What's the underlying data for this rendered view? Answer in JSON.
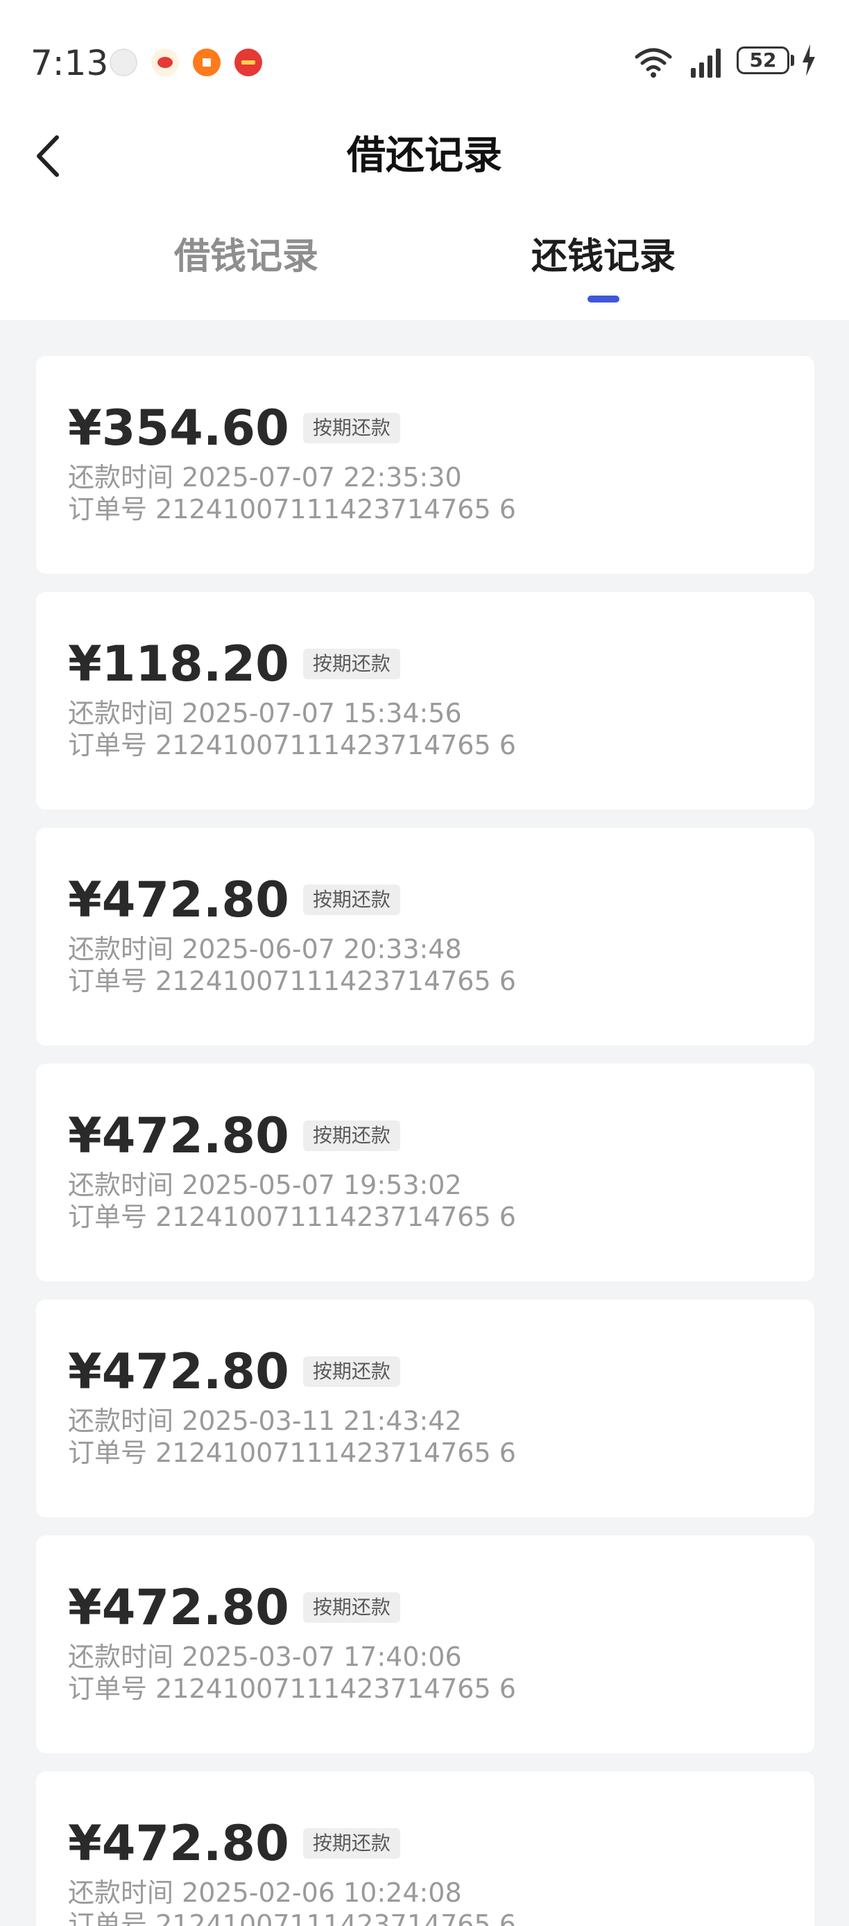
{
  "status_bar": {
    "time": "7:13",
    "battery": "52"
  },
  "header": {
    "title": "借还记录"
  },
  "tabs": [
    {
      "label": "借钱记录",
      "active": false
    },
    {
      "label": "还钱记录",
      "active": true
    }
  ],
  "colors": {
    "accent": "#3f56d8",
    "background": "#f3f4f6"
  },
  "records": [
    {
      "amount": "¥354.60",
      "tag": "按期还款",
      "time_text": "还款时间 2025-07-07 22:35:30",
      "order_text": "订单号 21241007111423714765 6"
    },
    {
      "amount": "¥118.20",
      "tag": "按期还款",
      "time_text": "还款时间 2025-07-07 15:34:56",
      "order_text": "订单号 21241007111423714765 6"
    },
    {
      "amount": "¥472.80",
      "tag": "按期还款",
      "time_text": "还款时间 2025-06-07 20:33:48",
      "order_text": "订单号 21241007111423714765 6"
    },
    {
      "amount": "¥472.80",
      "tag": "按期还款",
      "time_text": "还款时间 2025-05-07 19:53:02",
      "order_text": "订单号 21241007111423714765 6"
    },
    {
      "amount": "¥472.80",
      "tag": "按期还款",
      "time_text": "还款时间 2025-03-11 21:43:42",
      "order_text": "订单号 21241007111423714765 6"
    },
    {
      "amount": "¥472.80",
      "tag": "按期还款",
      "time_text": "还款时间 2025-03-07 17:40:06",
      "order_text": "订单号 21241007111423714765 6"
    },
    {
      "amount": "¥472.80",
      "tag": "按期还款",
      "time_text": "还款时间 2025-02-06 10:24:08",
      "order_text": "订单号 21241007111423714765 6"
    }
  ]
}
